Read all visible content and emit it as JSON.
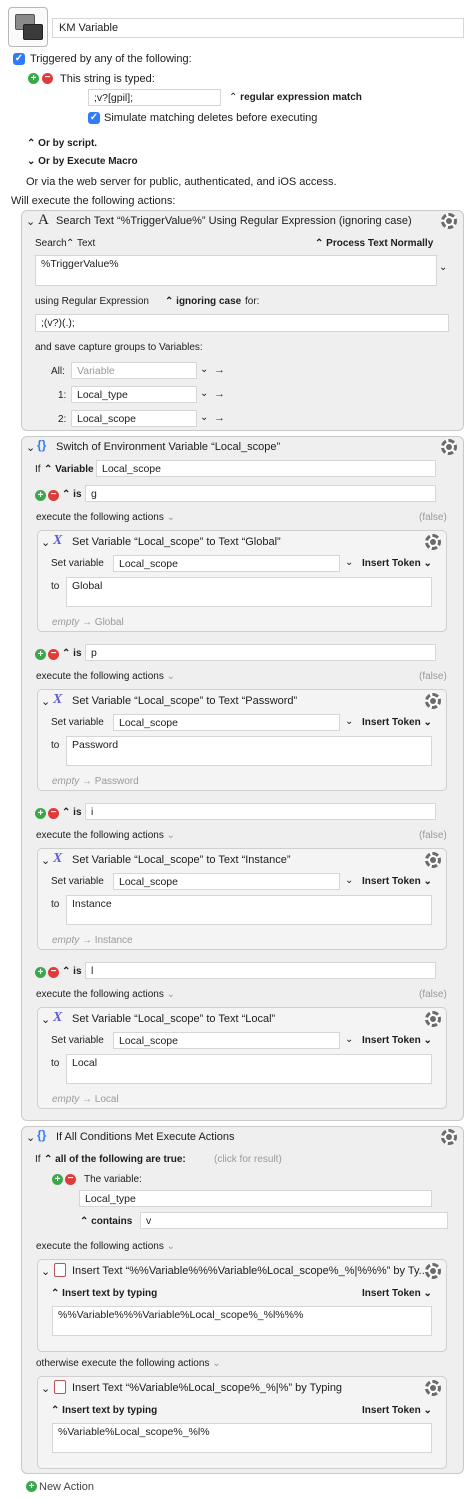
{
  "macro": {
    "name": "KM Variable"
  },
  "trigger": {
    "header": "Triggered by any of the following:",
    "string_label": "This string is typed:",
    "string_value": ";v?[gpil];",
    "match_mode": "regular expression match",
    "simulate_label": "Simulate matching deletes before executing",
    "or_script": "Or by script.",
    "or_execute": "Or by Execute Macro",
    "web_note": "Or via the web server for public, authenticated, and iOS access."
  },
  "will_execute": "Will execute the following actions:",
  "search_action": {
    "title": "Search Text “%TriggerValue%” Using Regular Expression (ignoring case)",
    "search_label": "Search",
    "source": "Text",
    "process_mode": "Process Text Normally",
    "text_value": "%TriggerValue%",
    "using_label": "using Regular Expression",
    "case_mode": "ignoring case",
    "for_label": "for:",
    "regex": ";(v?)(.);",
    "capture_label": "and save capture groups to Variables:",
    "groups": [
      {
        "label": "All:",
        "value": "",
        "placeholder": "Variable"
      },
      {
        "label": "1:",
        "value": "Local_type",
        "placeholder": ""
      },
      {
        "label": "2:",
        "value": "Local_scope",
        "placeholder": ""
      }
    ]
  },
  "switch_action": {
    "title": "Switch of Environment Variable “Local_scope”",
    "if_label": "If",
    "kind": "Variable",
    "variable": "Local_scope",
    "is_label": "is",
    "execute_label": "execute the following actions",
    "false_label": "(false)",
    "set_var_label": "Set variable",
    "to_label": "to",
    "insert_token": "Insert Token",
    "cases": [
      {
        "value": "g",
        "title": "Set Variable “Local_scope” to Text “Global”",
        "var": "Local_scope",
        "text": "Global",
        "empty": "empty",
        "preview": "Global"
      },
      {
        "value": "p",
        "title": "Set Variable “Local_scope” to Text “Password”",
        "var": "Local_scope",
        "text": "Password",
        "empty": "empty",
        "preview": "Password"
      },
      {
        "value": "i",
        "title": "Set Variable “Local_scope” to Text “Instance”",
        "var": "Local_scope",
        "text": "Instance",
        "empty": "empty",
        "preview": "Instance"
      },
      {
        "value": "l",
        "title": "Set Variable “Local_scope” to Text “Local”",
        "var": "Local_scope",
        "text": "Local",
        "empty": "empty",
        "preview": "Local"
      }
    ]
  },
  "if_action": {
    "title": "If All Conditions Met Execute Actions",
    "if_label": "If",
    "condition_mode": "all of the following are true:",
    "click_note": "(click for result)",
    "the_variable": "The variable:",
    "variable": "Local_type",
    "op": "contains",
    "op_value": "v",
    "execute_label": "execute the following actions",
    "otherwise_label": "otherwise execute the following actions",
    "insert_by_typing": "Insert text by typing",
    "insert_token": "Insert Token",
    "then_action": {
      "title": "Insert Text “%%Variable%%%Variable%Local_scope%_%|%%%” by Ty...",
      "text": "%%Variable%%%Variable%Local_scope%_%l%%%"
    },
    "else_action": {
      "title": "Insert Text “%Variable%Local_scope%_%|%” by Typing",
      "text": "%Variable%Local_scope%_%l%"
    }
  },
  "footer": {
    "new_action": "New Action"
  },
  "colors": {
    "accent": "#2f7cf6",
    "add": "#3aa84a",
    "remove": "#de3b3b",
    "panel": "#efefef"
  }
}
